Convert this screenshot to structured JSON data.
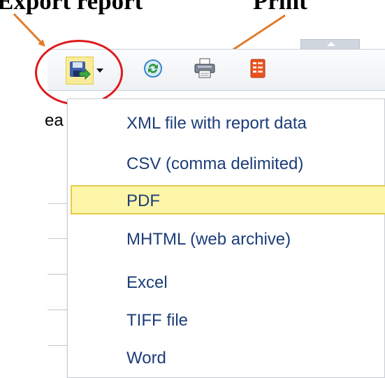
{
  "annotations": {
    "export_label": "Export report",
    "print_label": "Print",
    "arrow_color": "#e07b2a",
    "circle_color": "#e0191e"
  },
  "toolbar": {
    "buttons": [
      {
        "name": "export-report-button",
        "icon": "save-disk-icon"
      },
      {
        "name": "refresh-button",
        "icon": "refresh-icon"
      },
      {
        "name": "print-button",
        "icon": "printer-icon"
      },
      {
        "name": "report-button",
        "icon": "report-icon"
      }
    ]
  },
  "background_text": "ea",
  "export_menu": {
    "items": [
      {
        "label": "XML file with report data"
      },
      {
        "label": "CSV (comma delimited)"
      },
      {
        "label": "PDF",
        "selected": true
      },
      {
        "label": "MHTML (web archive)"
      },
      {
        "label": "Excel"
      },
      {
        "label": "TIFF file"
      },
      {
        "label": "Word"
      }
    ]
  },
  "colors": {
    "menu_text": "#1c3d78",
    "selected_bg": "#fdf6a8",
    "selected_border": "#e7cb4a",
    "toolbar_bg": "#eef1f4"
  }
}
